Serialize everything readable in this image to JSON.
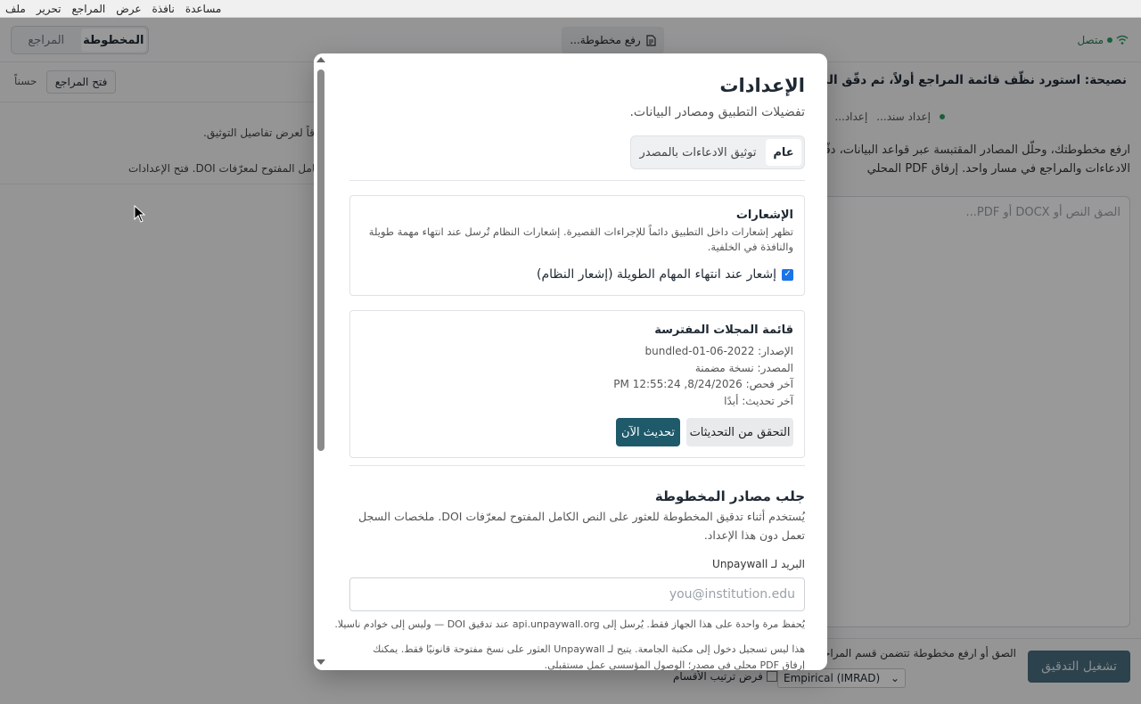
{
  "menubar": {
    "items": [
      "ملف",
      "تحرير",
      "المراجع",
      "عرض",
      "نافذة",
      "مساعدة"
    ]
  },
  "toolbar": {
    "status": "متصل",
    "upload_label": "رفع مخطوطة...",
    "tab_manuscript": "المخطوطة",
    "tab_references": "المراجع"
  },
  "right_pane": {
    "tip": "نصيحة: استورد نظّف قائمة المراجع أولاً، ثم دقّق المخطوطة",
    "step_a": "إعداد...",
    "step_b": "إعداد سند...",
    "intro": "ارفع مخطوطتك، وحلّل المصادر المقتبسة عبر قواعد البيانات، دقّق الادعاءات والمراجع في مسار واحد. إرفاق PDF المحلي",
    "textarea_placeholder": "الصق النص أو DOCX أو PDF...",
    "hint": "الصق أو ارفع مخطوطة تتضمن قسم المراجع",
    "run_button": "تشغيل التدقيق",
    "structure": "Empirical (IMRAD)",
    "order_label": "فرض ترتيب الأقسام"
  },
  "left_pane": {
    "open_refs": "فتح المراجع",
    "ok": "حسناً",
    "verify_note": "قاً لعرض تفاصيل التوثيق.",
    "doi_note": "كامل المفتوح لمعرّفات DOI. فتح الإعدادات"
  },
  "modal": {
    "title": "الإعدادات",
    "subtitle": "تفضيلات التطبيق ومصادر البيانات.",
    "tab_general": "عام",
    "tab_claims": "توثيق الادعاءات بالمصدر",
    "notifications": {
      "title": "الإشعارات",
      "desc": "تظهر إشعارات داخل التطبيق دائماً للإجراءات القصيرة. إشعارات النظام تُرسل عند انتهاء مهمة طويلة والنافذة في الخلفية.",
      "checkbox_label": "إشعار عند انتهاء المهام الطويلة (إشعار النظام)",
      "checked": true
    },
    "journals": {
      "title": "قائمة المجلات المفترسة",
      "version": "الإصدار: bundled-01-06-2022",
      "source": "المصدر: نسخة مضمنة",
      "last_check": "آخر فحص: 8/24/2026, 12:55:24 PM",
      "last_update": "آخر تحديث: أبدًا",
      "check_button": "التحقق من التحديثات",
      "update_button": "تحديث الآن"
    },
    "sources": {
      "title": "جلب مصادر المخطوطة",
      "desc": "يُستخدم أثناء تدقيق المخطوطة للعثور على النص الكامل المفتوح لمعرّفات DOI. ملخصات السجل تعمل دون هذا الإعداد.",
      "email_label": "البريد لـ Unpaywall",
      "email_placeholder": "you@institution.edu",
      "note1": "يُحفظ مرة واحدة على هذا الجهاز فقط. يُرسل إلى api.unpaywall.org عند تدقيق DOI — وليس إلى خوادم ناسيلا.",
      "note2": "هذا ليس تسجيل دخول إلى مكتبة الجامعة. يتيح لـ Unpaywall العثور على نسخ مفتوحة قانونيًا فقط. يمكنك إرفاق PDF محلي في مصدر؛ الوصول المؤسسي عمل مستقبلي."
    }
  },
  "colors": {
    "primary": "#1f5a6b",
    "success": "#2e9d5f",
    "checkbox": "#1a73e8"
  }
}
